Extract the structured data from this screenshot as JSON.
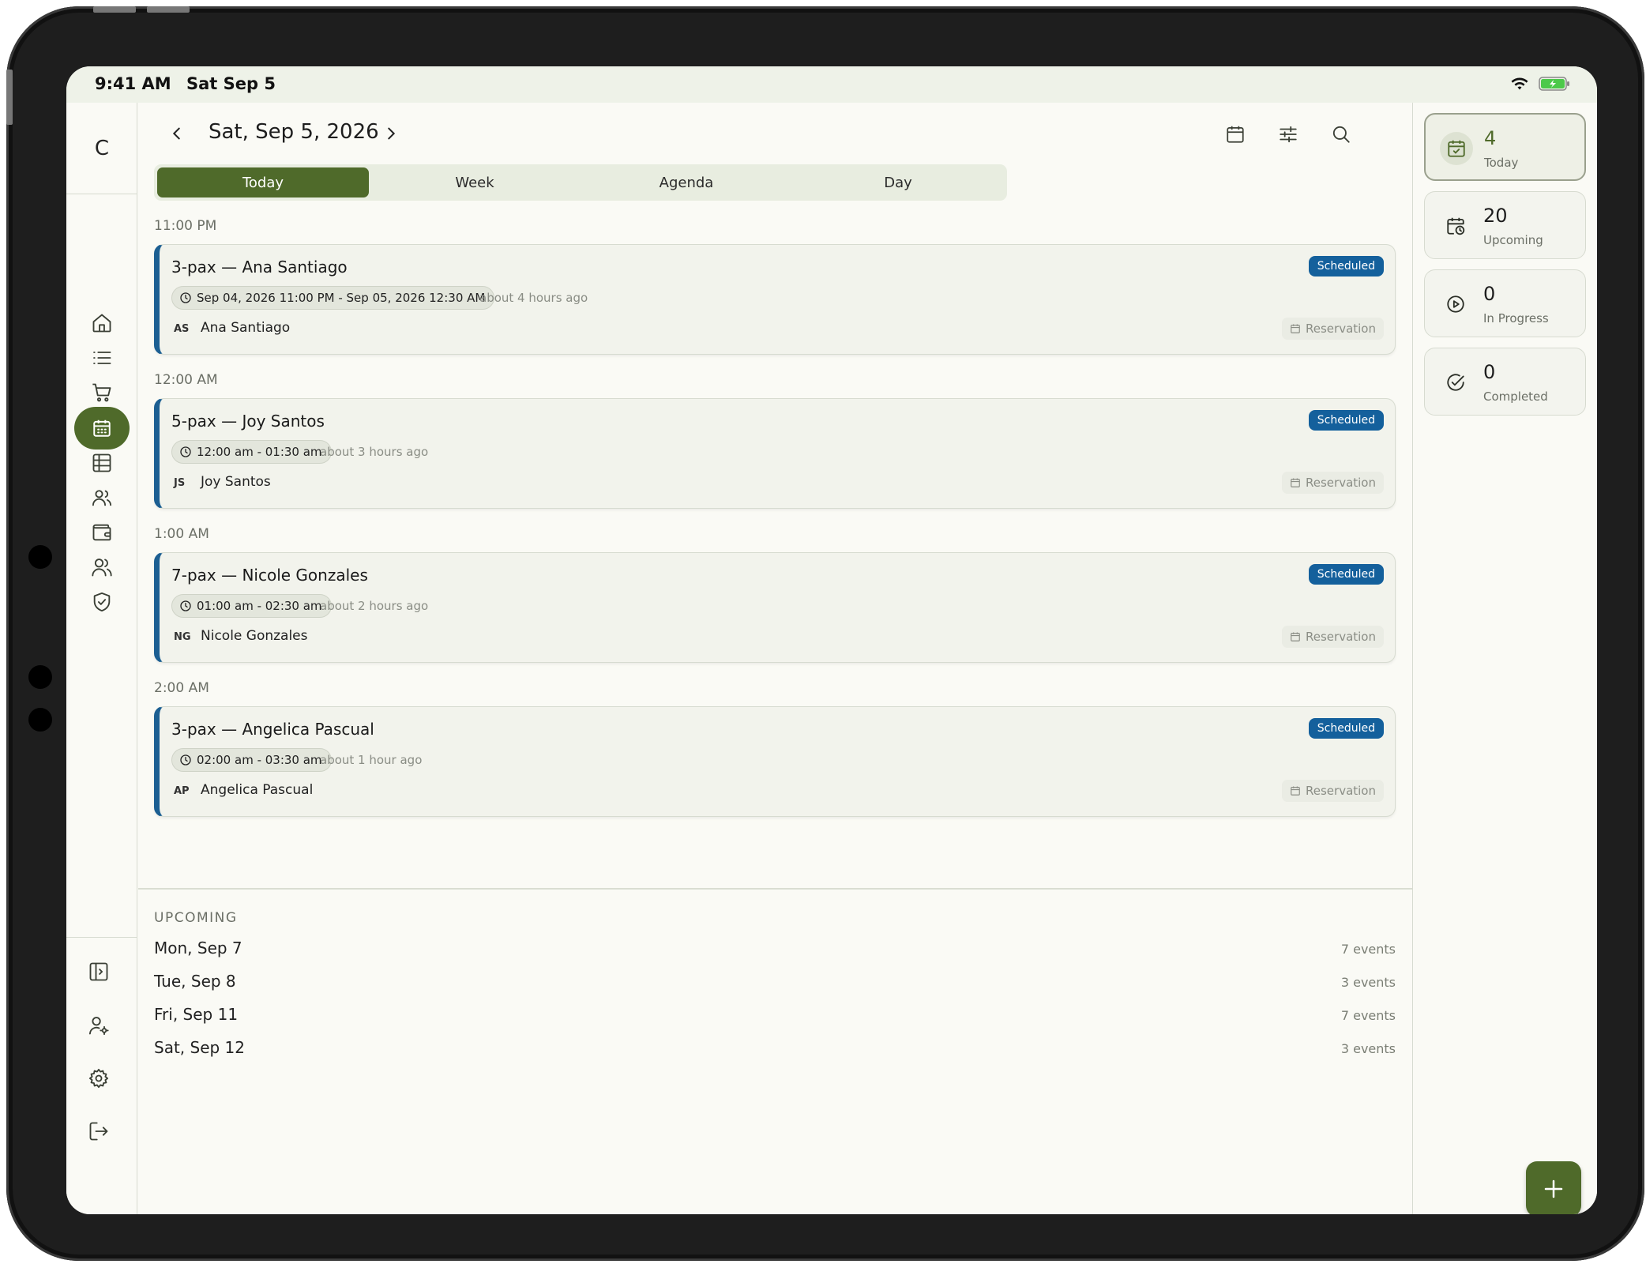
{
  "status_bar": {
    "time": "9:41 AM",
    "date": "Sat Sep 5"
  },
  "rail": {
    "logo": "C",
    "items": [
      {
        "icon": "home-icon"
      },
      {
        "icon": "list-icon"
      },
      {
        "icon": "cart-icon"
      },
      {
        "icon": "calendar-icon",
        "active": true
      },
      {
        "icon": "table-icon"
      },
      {
        "icon": "users-icon"
      },
      {
        "icon": "wallet-icon"
      },
      {
        "icon": "team-icon"
      },
      {
        "icon": "shield-icon"
      }
    ],
    "bottom_items": [
      {
        "icon": "sidebar-toggle-icon"
      },
      {
        "icon": "user-settings-icon"
      },
      {
        "icon": "gear-icon"
      },
      {
        "icon": "logout-icon"
      }
    ]
  },
  "header": {
    "date": "Sat, Sep 5, 2026"
  },
  "tabs": [
    {
      "label": "Today",
      "active": true
    },
    {
      "label": "Week"
    },
    {
      "label": "Agenda"
    },
    {
      "label": "Day"
    }
  ],
  "events": [
    {
      "time_label": "11:00 PM",
      "title": "3-pax — Ana Santiago",
      "status": "Scheduled",
      "time_range": "Sep 04, 2026 11:00 PM - Sep 05, 2026 12:30 AM",
      "ago": "about 4 hours ago",
      "initials": "AS",
      "name": "Ana Santiago",
      "tag": "Reservation"
    },
    {
      "time_label": "12:00 AM",
      "title": "5-pax — Joy Santos",
      "status": "Scheduled",
      "time_range": "12:00 am - 01:30 am",
      "ago": "about 3 hours ago",
      "initials": "JS",
      "name": "Joy Santos",
      "tag": "Reservation"
    },
    {
      "time_label": "1:00 AM",
      "title": "7-pax — Nicole Gonzales",
      "status": "Scheduled",
      "time_range": "01:00 am - 02:30 am",
      "ago": "about 2 hours ago",
      "initials": "NG",
      "name": "Nicole Gonzales",
      "tag": "Reservation"
    },
    {
      "time_label": "2:00 AM",
      "title": "3-pax — Angelica Pascual",
      "status": "Scheduled",
      "time_range": "02:00 am - 03:30 am",
      "ago": "about 1 hour ago",
      "initials": "AP",
      "name": "Angelica Pascual",
      "tag": "Reservation"
    }
  ],
  "upcoming": {
    "title": "UPCOMING",
    "items": [
      {
        "date": "Mon, Sep 7",
        "count": "7 events"
      },
      {
        "date": "Tue, Sep 8",
        "count": "3 events"
      },
      {
        "date": "Fri, Sep 11",
        "count": "7 events"
      },
      {
        "date": "Sat, Sep 12",
        "count": "3 events"
      }
    ]
  },
  "stats": [
    {
      "value": "4",
      "label": "Today",
      "icon": "calendar-check-icon",
      "active": true
    },
    {
      "value": "20",
      "label": "Upcoming",
      "icon": "calendar-clock-icon"
    },
    {
      "value": "0",
      "label": "In Progress",
      "icon": "play-circle-icon"
    },
    {
      "value": "0",
      "label": "Completed",
      "icon": "check-circle-icon"
    }
  ],
  "colors": {
    "accent": "#4f6a2a",
    "status_blue": "#14609c",
    "background": "#fafaf5"
  }
}
